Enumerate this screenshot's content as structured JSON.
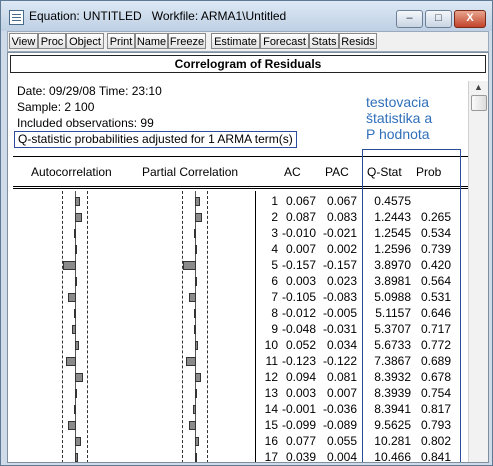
{
  "window": {
    "title": "Equation: UNTITLED   Workfile: ARMA1\\Untitled",
    "min_label": "–",
    "max_label": "□",
    "close_label": "X"
  },
  "toolbar": [
    "View",
    "Proc",
    "Object",
    "Print",
    "Name",
    "Freeze",
    "Estimate",
    "Forecast",
    "Stats",
    "Resids"
  ],
  "report": {
    "header": "Correlogram of Residuals",
    "date_line": "Date: 09/29/08   Time: 23:10",
    "sample_line": "Sample: 2 100",
    "obs_line": "Included observations: 99",
    "adjust_line": "Q-statistic probabilities adjusted for 1 ARMA term(s)",
    "note_lines": [
      "testovacia",
      "štatistika a",
      "P hodnota"
    ]
  },
  "columns": {
    "autocorrelation": "Autocorrelation",
    "partial": "Partial Correlation",
    "ac": "AC",
    "pac": "PAC",
    "qstat": "Q-Stat",
    "prob": "Prob"
  },
  "rows": [
    {
      "lag": "1",
      "ac": "0.067",
      "pac": "0.067",
      "q": "0.4575",
      "prob": ""
    },
    {
      "lag": "2",
      "ac": "0.087",
      "pac": "0.083",
      "q": "1.2443",
      "prob": "0.265"
    },
    {
      "lag": "3",
      "ac": "-0.010",
      "pac": "-0.021",
      "q": "1.2545",
      "prob": "0.534"
    },
    {
      "lag": "4",
      "ac": "0.007",
      "pac": "0.002",
      "q": "1.2596",
      "prob": "0.739"
    },
    {
      "lag": "5",
      "ac": "-0.157",
      "pac": "-0.157",
      "q": "3.8970",
      "prob": "0.420"
    },
    {
      "lag": "6",
      "ac": "0.003",
      "pac": "0.023",
      "q": "3.8981",
      "prob": "0.564"
    },
    {
      "lag": "7",
      "ac": "-0.105",
      "pac": "-0.083",
      "q": "5.0988",
      "prob": "0.531"
    },
    {
      "lag": "8",
      "ac": "-0.012",
      "pac": "-0.005",
      "q": "5.1157",
      "prob": "0.646"
    },
    {
      "lag": "9",
      "ac": "-0.048",
      "pac": "-0.031",
      "q": "5.3707",
      "prob": "0.717"
    },
    {
      "lag": "10",
      "ac": "0.052",
      "pac": "0.034",
      "q": "5.6733",
      "prob": "0.772"
    },
    {
      "lag": "11",
      "ac": "-0.123",
      "pac": "-0.122",
      "q": "7.3867",
      "prob": "0.689"
    },
    {
      "lag": "12",
      "ac": "0.094",
      "pac": "0.081",
      "q": "8.3932",
      "prob": "0.678"
    },
    {
      "lag": "13",
      "ac": "0.003",
      "pac": "0.007",
      "q": "8.3939",
      "prob": "0.754"
    },
    {
      "lag": "14",
      "ac": "-0.001",
      "pac": "-0.036",
      "q": "8.3941",
      "prob": "0.817"
    },
    {
      "lag": "15",
      "ac": "-0.099",
      "pac": "-0.089",
      "q": "9.5625",
      "prob": "0.793"
    },
    {
      "lag": "16",
      "ac": "0.077",
      "pac": "0.055",
      "q": "10.281",
      "prob": "0.802"
    },
    {
      "lag": "17",
      "ac": "0.039",
      "pac": "0.004",
      "q": "10.466",
      "prob": "0.841"
    }
  ]
}
